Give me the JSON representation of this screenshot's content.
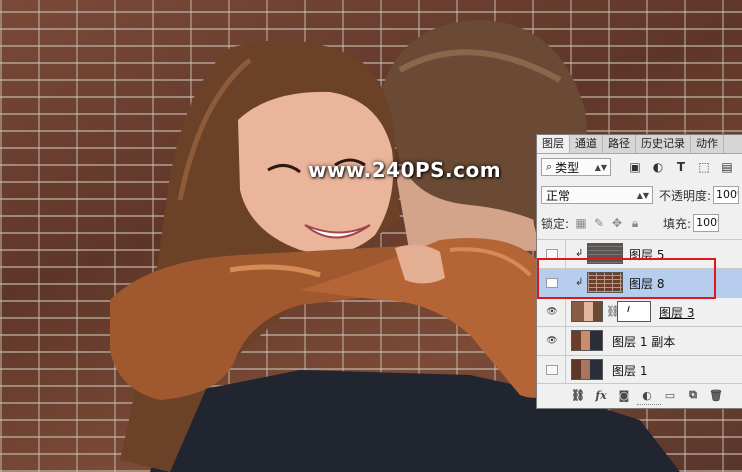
{
  "watermark": "www.240PS.com",
  "panel": {
    "tabs": [
      "图层",
      "通道",
      "路径",
      "历史记录",
      "动作"
    ],
    "filter": {
      "label": "类型",
      "search_icon": "search-icon"
    },
    "blend_mode": "正常",
    "opacity_label": "不透明度:",
    "opacity_value": "100%",
    "lock_label": "锁定:",
    "fill_label": "填充:",
    "fill_value": "100%",
    "layers": [
      {
        "name": "图层 5",
        "visible": false,
        "clipped": true,
        "selected": false
      },
      {
        "name": "图层 8",
        "visible": false,
        "clipped": true,
        "selected": true
      },
      {
        "name": "图层 3",
        "visible": true,
        "clipped": false,
        "selected": false,
        "has_mask": true
      },
      {
        "name": "图层 1 副本",
        "visible": true,
        "clipped": false,
        "selected": false
      },
      {
        "name": "图层 1",
        "visible": false,
        "clipped": false,
        "selected": false
      }
    ],
    "bottom_icons": [
      "link-icon",
      "fx-icon",
      "mask-icon",
      "adjustment-icon",
      "folder-icon",
      "new-layer-icon",
      "trash-icon"
    ],
    "fx_label": "fx"
  },
  "colors": {
    "highlight_box": "#e0161f",
    "selected_layer": "#b6cdee",
    "panel_bg": "#f0f0f0"
  }
}
